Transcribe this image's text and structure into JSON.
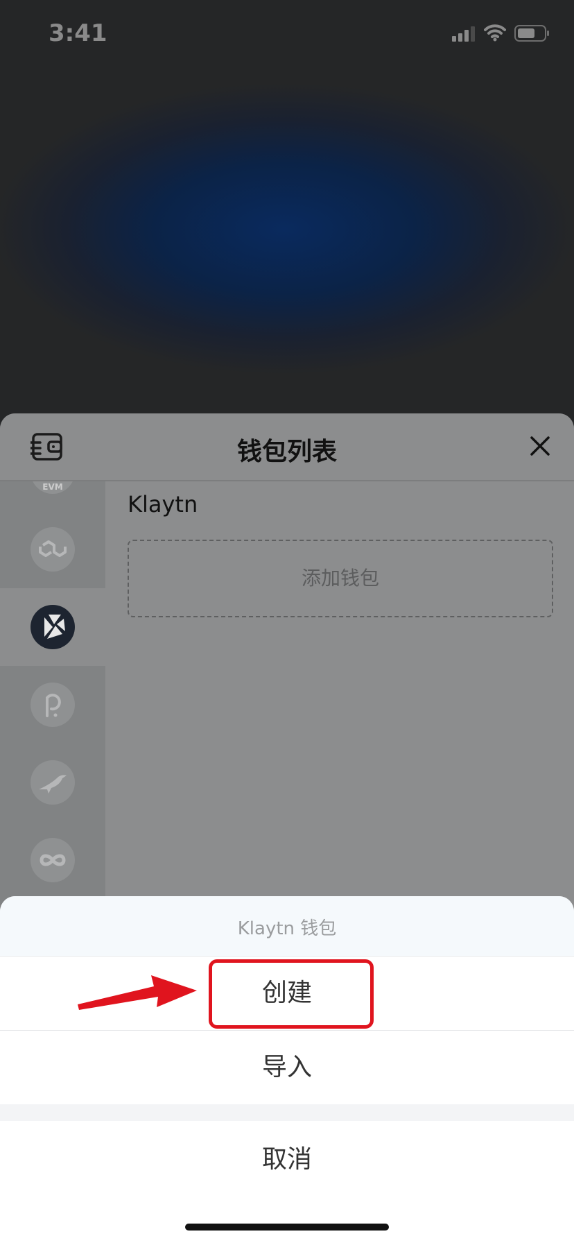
{
  "status_bar": {
    "time": "3:41",
    "icons": [
      "signal-icon",
      "wifi-icon",
      "battery-icon"
    ]
  },
  "wallet_panel": {
    "title": "钱包列表",
    "header_icon": "wallet-list-icon",
    "close_icon": "close-icon",
    "chains": [
      {
        "icon": "evm-chain-icon",
        "active": false
      },
      {
        "icon": "polygon-icon",
        "active": false
      },
      {
        "icon": "klaytn-icon",
        "active": true
      },
      {
        "icon": "polkadot-icon",
        "active": false
      },
      {
        "icon": "bird-chain-icon",
        "active": false
      },
      {
        "icon": "infinity-chain-icon",
        "active": false
      }
    ],
    "chain_name": "Klaytn",
    "add_wallet_label": "添加钱包"
  },
  "action_sheet": {
    "title": "Klaytn 钱包",
    "create_label": "创建",
    "import_label": "导入",
    "cancel_label": "取消"
  },
  "annotation": {
    "highlight_color": "#e0141e"
  }
}
